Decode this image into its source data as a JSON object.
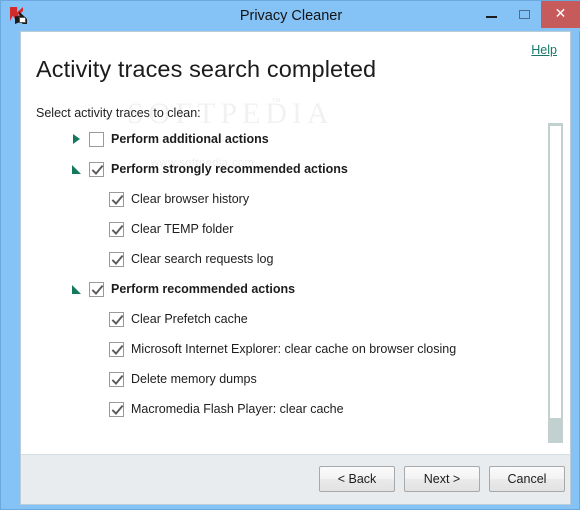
{
  "window": {
    "title": "Privacy Cleaner",
    "icon": "kaspersky-k-icon",
    "controls": {
      "minimize": "–",
      "maximize": "□",
      "close": "✕"
    },
    "colors": {
      "titlebar": "#85c2f5",
      "close_button": "#c75b5b",
      "accent_green": "#14795c",
      "help_link": "#16786a",
      "footer": "#e8ecef"
    }
  },
  "header": {
    "help_label": "Help",
    "page_title": "Activity traces search completed",
    "subtitle": "Select activity traces to clean:"
  },
  "watermark": {
    "brand": "SOFTPEDIA",
    "tm": "™",
    "url": "www.softpedia.com"
  },
  "tree": {
    "rows": [
      {
        "label": "Perform additional actions",
        "level": 0,
        "bold": true,
        "checked": false,
        "expander": "collapsed"
      },
      {
        "label": "Perform strongly recommended actions",
        "level": 0,
        "bold": true,
        "checked": true,
        "expander": "expanded"
      },
      {
        "label": "Clear browser history",
        "level": 1,
        "bold": false,
        "checked": true,
        "expander": "none"
      },
      {
        "label": "Clear TEMP folder",
        "level": 1,
        "bold": false,
        "checked": true,
        "expander": "none"
      },
      {
        "label": "Clear search requests log",
        "level": 1,
        "bold": false,
        "checked": true,
        "expander": "none"
      },
      {
        "label": "Perform recommended actions",
        "level": 0,
        "bold": true,
        "checked": true,
        "expander": "expanded"
      },
      {
        "label": "Clear Prefetch cache",
        "level": 1,
        "bold": false,
        "checked": true,
        "expander": "none"
      },
      {
        "label": "Microsoft Internet Explorer: clear cache on browser closing",
        "level": 1,
        "bold": false,
        "checked": true,
        "expander": "none"
      },
      {
        "label": "Delete memory dumps",
        "level": 1,
        "bold": false,
        "checked": true,
        "expander": "none"
      },
      {
        "label": "Macromedia Flash Player: clear cache",
        "level": 1,
        "bold": false,
        "checked": true,
        "expander": "none"
      }
    ]
  },
  "scrollbar": {
    "orientation": "vertical",
    "thumb_position_percent": 0,
    "thumb_size_percent": 91
  },
  "footer": {
    "buttons": [
      {
        "label": "< Back",
        "name": "back-button"
      },
      {
        "label": "Next >",
        "name": "next-button"
      },
      {
        "label": "Cancel",
        "name": "cancel-button"
      }
    ]
  }
}
